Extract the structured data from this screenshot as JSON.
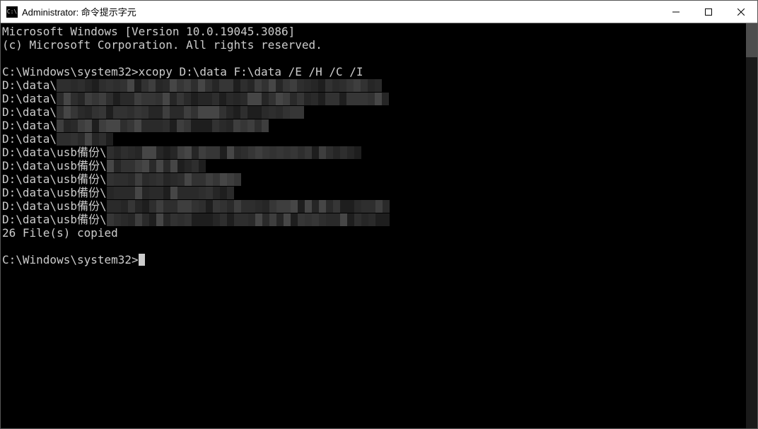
{
  "titlebar": {
    "icon_text": "C:\\",
    "title": "Administrator: 命令提示字元"
  },
  "terminal": {
    "header1": "Microsoft Windows [Version 10.0.19045.3086]",
    "header2": "(c) Microsoft Corporation. All rights reserved.",
    "prompt1": "C:\\Windows\\system32>",
    "command1": "xcopy D:\\data F:\\data /E /H /C /I",
    "lines": [
      {
        "prefix": "D:\\data\\",
        "mosaic": 46
      },
      {
        "prefix": "D:\\data\\",
        "mosaic": 47
      },
      {
        "prefix": "D:\\data\\",
        "mosaic": 35
      },
      {
        "prefix": "D:\\data\\",
        "mosaic": 30
      },
      {
        "prefix": "D:\\data\\",
        "mosaic": 8
      },
      {
        "prefix": "D:\\data\\usb備份\\",
        "mosaic": 36
      },
      {
        "prefix": "D:\\data\\usb備份\\",
        "mosaic": 14
      },
      {
        "prefix": "D:\\data\\usb備份\\",
        "mosaic": 19
      },
      {
        "prefix": "D:\\data\\usb備份\\",
        "mosaic": 18
      },
      {
        "prefix": "D:\\data\\usb備份\\",
        "mosaic": 40
      },
      {
        "prefix": "D:\\data\\usb備份\\",
        "mosaic": 40
      }
    ],
    "summary": "26 File(s) copied",
    "prompt2": "C:\\Windows\\system32>"
  },
  "mosaic_shades": [
    "#1e1e1e",
    "#262626",
    "#2e2e2e",
    "#363636",
    "#3e3e3e",
    "#464646",
    "#323232",
    "#2a2a2a"
  ]
}
